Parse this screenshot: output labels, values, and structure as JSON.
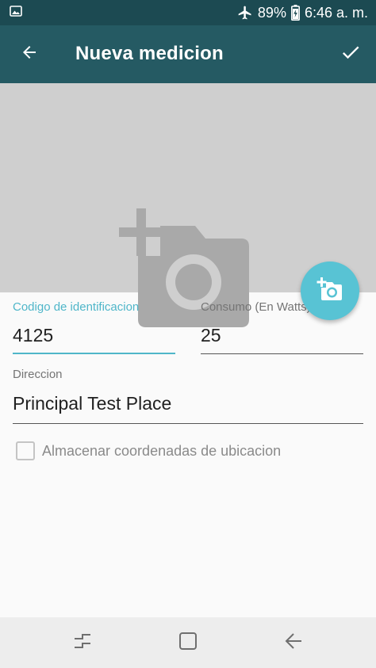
{
  "status_bar": {
    "battery": "89%",
    "time": "6:46 a. m.",
    "icons": [
      "image-notification-icon",
      "airplane-mode-icon",
      "battery-charging-icon"
    ]
  },
  "app_bar": {
    "title": "Nueva medicion",
    "back_icon": "arrow-left-icon",
    "confirm_icon": "check-icon",
    "color": "#255a63"
  },
  "photo": {
    "placeholder_icon": "add-a-photo-icon",
    "background": "#cfcfcf"
  },
  "fab": {
    "icon": "add-a-photo-icon",
    "color": "#58c3d4"
  },
  "form": {
    "codigo": {
      "label": "Codigo de identificacion",
      "value": "4125",
      "focused": true
    },
    "consumo": {
      "label": "Consumo (En Watts)",
      "value": "25"
    },
    "direccion": {
      "label": "Direccion",
      "value": "Principal Test Place"
    },
    "checkbox": {
      "label": "Almacenar coordenadas de ubicacion",
      "checked": false
    }
  },
  "accent_color": "#4fb6c9",
  "nav_bar": {
    "buttons": [
      "recent-apps-icon",
      "home-icon",
      "back-icon"
    ]
  }
}
